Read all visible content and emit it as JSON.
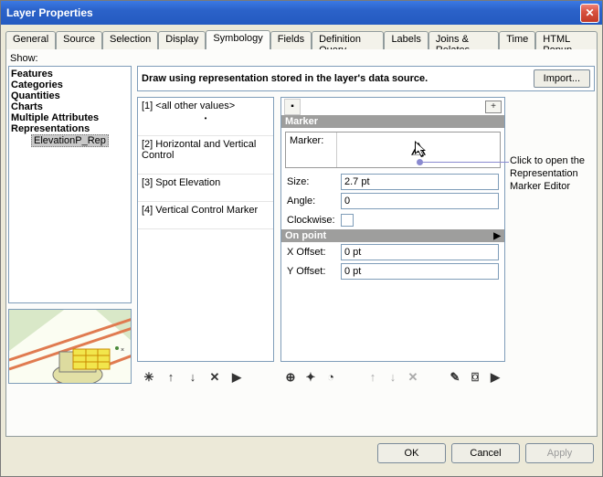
{
  "title": "Layer Properties",
  "tabs": [
    "General",
    "Source",
    "Selection",
    "Display",
    "Symbology",
    "Fields",
    "Definition Query",
    "Labels",
    "Joins & Relates",
    "Time",
    "HTML Popup"
  ],
  "active_tab_index": 4,
  "show_label": "Show:",
  "tree": {
    "items": [
      "Features",
      "Categories",
      "Quantities",
      "Charts",
      "Multiple Attributes",
      "Representations"
    ],
    "child": "ElevationP_Rep"
  },
  "instruction": "Draw using representation stored in the layer's data source.",
  "import_label": "Import...",
  "symbols": [
    "[1] <all other values>",
    "[2] Horizontal and Vertical Control",
    "[3] Spot Elevation",
    "[4] Vertical Control Marker"
  ],
  "marker": {
    "header": "Marker",
    "marker_label": "Marker:",
    "size_label": "Size:",
    "size_value": "2.7 pt",
    "angle_label": "Angle:",
    "angle_value": "0",
    "clockwise_label": "Clockwise:",
    "onpoint_header": "On point",
    "x_off_label": "X Offset:",
    "x_off_value": "0 pt",
    "y_off_label": "Y Offset:",
    "y_off_value": "0 pt"
  },
  "annotation": "Click to open the Representation Marker Editor",
  "buttons": {
    "ok": "OK",
    "cancel": "Cancel",
    "apply": "Apply"
  }
}
